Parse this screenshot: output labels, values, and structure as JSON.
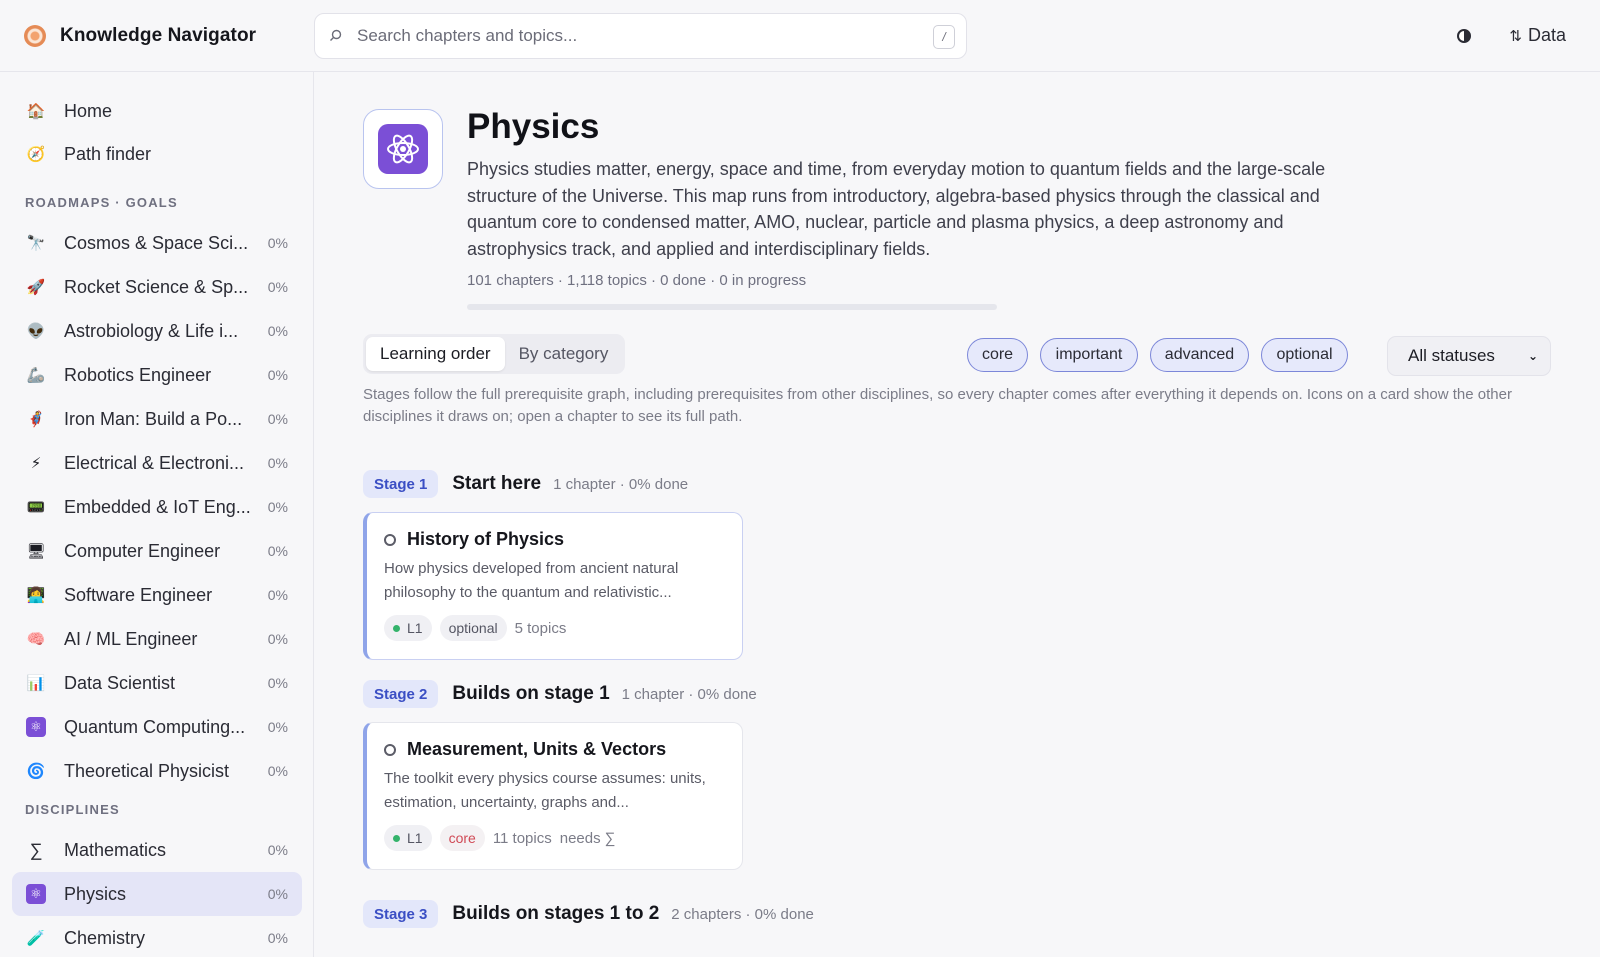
{
  "app": {
    "title": "Knowledge Navigator",
    "data_button_label": "Data"
  },
  "search": {
    "placeholder": "Search chapters and topics...",
    "shortcut": "/"
  },
  "sidebar": {
    "top_items": [
      {
        "icon": "house-icon",
        "glyph": "🏠",
        "label": "Home"
      },
      {
        "icon": "compass-icon",
        "glyph": "🧭",
        "label": "Path finder"
      }
    ],
    "roadmaps_heading": "ROADMAPS · GOALS",
    "roadmaps": [
      {
        "icon": "telescope-icon",
        "glyph": "🔭",
        "label": "Cosmos & Space Sci...",
        "pct": "0%"
      },
      {
        "icon": "rocket-icon",
        "glyph": "🚀",
        "label": "Rocket Science & Sp...",
        "pct": "0%"
      },
      {
        "icon": "alien-icon",
        "glyph": "👽",
        "label": "Astrobiology & Life i...",
        "pct": "0%"
      },
      {
        "icon": "robot-arm-icon",
        "glyph": "🦾",
        "label": "Robotics Engineer",
        "pct": "0%"
      },
      {
        "icon": "person-icon",
        "glyph": "🦸",
        "label": "Iron Man: Build a Po...",
        "pct": "0%"
      },
      {
        "icon": "lightning-icon",
        "glyph": "⚡",
        "label": "Electrical & Electroni...",
        "pct": "0%"
      },
      {
        "icon": "chip-icon",
        "glyph": "📟",
        "label": "Embedded & IoT Eng...",
        "pct": "0%"
      },
      {
        "icon": "computer-icon",
        "glyph": "🖥",
        "label": "Computer Engineer",
        "pct": "0%"
      },
      {
        "icon": "developer-icon",
        "glyph": "👩‍💻",
        "label": "Software Engineer",
        "pct": "0%"
      },
      {
        "icon": "brain-icon",
        "glyph": "🧠",
        "label": "AI / ML Engineer",
        "pct": "0%"
      },
      {
        "icon": "bar-chart-icon",
        "glyph": "📊",
        "label": "Data Scientist",
        "pct": "0%"
      },
      {
        "icon": "atom-icon",
        "glyph": "⚛",
        "label": "Quantum Computing...",
        "pct": "0%"
      },
      {
        "icon": "spiral-icon",
        "glyph": "🌀",
        "label": "Theoretical Physicist",
        "pct": "0%"
      }
    ],
    "disciplines_heading": "DISCIPLINES",
    "disciplines": [
      {
        "icon": "sigma-icon",
        "glyph": "∑",
        "label": "Mathematics",
        "pct": "0%",
        "active": false
      },
      {
        "icon": "atom-icon",
        "glyph": "⚛",
        "label": "Physics",
        "pct": "0%",
        "active": true
      },
      {
        "icon": "flask-icon",
        "glyph": "🧪",
        "label": "Chemistry",
        "pct": "0%",
        "active": false
      }
    ]
  },
  "discipline": {
    "title": "Physics",
    "description": "Physics studies matter, energy, space and time, from everyday motion to quantum fields and the large-scale structure of the Universe. This map runs from introductory, algebra-based physics through the classical and quantum core to condensed matter, AMO, nuclear, particle and plasma physics, a deep astronomy and astrophysics track, and applied and interdisciplinary fields.",
    "meta": "101 chapters · 1,118 topics · 0 done · 0 in progress",
    "progress_fraction": 0,
    "accent_color": "#7b4fd6"
  },
  "view_toggle": {
    "options": [
      "Learning order",
      "By category"
    ],
    "selected": "Learning order"
  },
  "filters": {
    "chips": [
      "core",
      "important",
      "advanced",
      "optional"
    ],
    "status_select": "All statuses"
  },
  "help_text": "Stages follow the full prerequisite graph, including prerequisites from other disciplines, so every chapter comes after everything it depends on. Icons on a card show the other disciplines it draws on; open a chapter to see its full path.",
  "stages": [
    {
      "badge": "Stage 1",
      "title": "Start here",
      "meta": "1 chapter · 0% done",
      "chapters": [
        {
          "title": "History of Physics",
          "description": "How physics developed from ancient natural philosophy to the quantum and relativistic...",
          "level": "L1",
          "importance": "optional",
          "topics": "5 topics",
          "needs": ""
        }
      ]
    },
    {
      "badge": "Stage 2",
      "title": "Builds on stage 1",
      "meta": "1 chapter · 0% done",
      "chapters": [
        {
          "title": "Measurement, Units & Vectors",
          "description": "The toolkit every physics course assumes: units, estimation, uncertainty, graphs and...",
          "level": "L1",
          "importance": "core",
          "topics": "11 topics",
          "needs": "needs ∑"
        }
      ]
    },
    {
      "badge": "Stage 3",
      "title": "Builds on stages 1 to 2",
      "meta": "2 chapters · 0% done",
      "chapters": []
    }
  ]
}
